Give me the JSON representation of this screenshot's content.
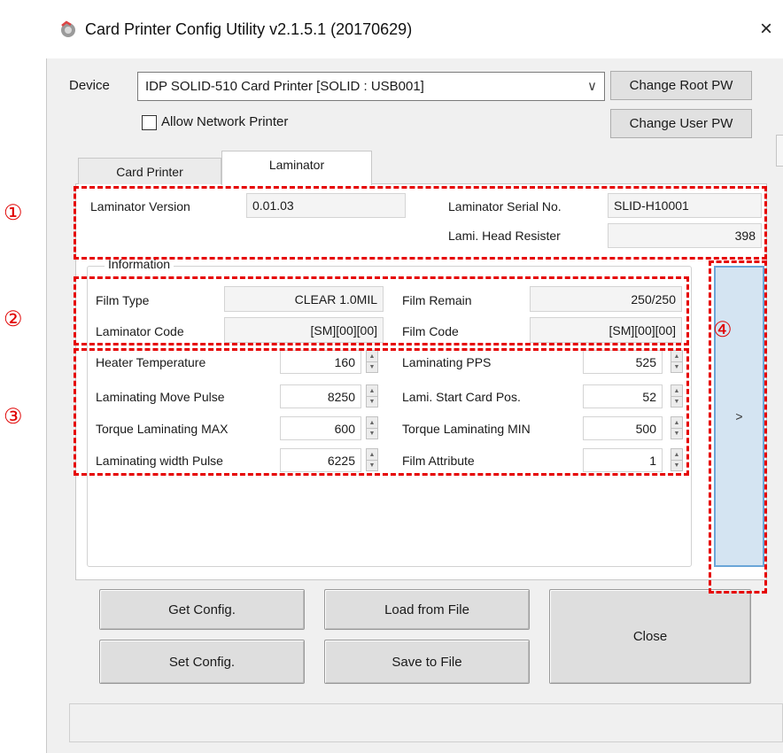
{
  "window": {
    "title": "Card Printer Config Utility v2.1.5.1 (20170629)",
    "close_glyph": "×"
  },
  "device": {
    "label": "Device",
    "selected": "IDP SOLID-510 Card Printer  [SOLID : USB001]",
    "dropdown_glyph": "∨",
    "change_root_pw": "Change Root PW",
    "change_user_pw": "Change User PW",
    "allow_network_label": "Allow Network Printer",
    "allow_network_checked": false
  },
  "tabs": [
    {
      "label": "Card Printer",
      "active": false
    },
    {
      "label": "Laminator",
      "active": true
    }
  ],
  "laminator": {
    "version_label": "Laminator Version",
    "version_value": "0.01.03",
    "serial_label": "Laminator Serial No.",
    "serial_value": "SLID-H10001",
    "head_resister_label": "Lami. Head Resister",
    "head_resister_value": "398"
  },
  "information": {
    "title": "Information",
    "film_type_label": "Film Type",
    "film_type_value": "CLEAR 1.0MIL",
    "film_remain_label": "Film Remain",
    "film_remain_value": "250/250",
    "laminator_code_label": "Laminator Code",
    "laminator_code_value": "[SM][00][00]",
    "film_code_label": "Film Code",
    "film_code_value": "[SM][00][00]"
  },
  "params": [
    {
      "label": "Heater Temperature",
      "value": "160"
    },
    {
      "label": "Laminating PPS",
      "value": "525"
    },
    {
      "label": "Laminating Move Pulse",
      "value": "8250"
    },
    {
      "label": "Lami. Start Card Pos.",
      "value": "52"
    },
    {
      "label": "Torque Laminating MAX",
      "value": "600"
    },
    {
      "label": "Torque Laminating MIN",
      "value": "500"
    },
    {
      "label": "Laminating width Pulse",
      "value": "6225"
    },
    {
      "label": "Film Attribute",
      "value": "1"
    }
  ],
  "side_button": {
    "label": ">"
  },
  "buttons": {
    "get_config": "Get Config.",
    "set_config": "Set Config.",
    "load_from_file": "Load from File",
    "save_to_file": "Save to File",
    "close": "Close"
  },
  "markers": [
    "①",
    "②",
    "③",
    "④"
  ],
  "colors": {
    "annotation": "#e60000",
    "side_button_border": "#6aa6d8",
    "side_button_fill": "#d4e4f2"
  }
}
